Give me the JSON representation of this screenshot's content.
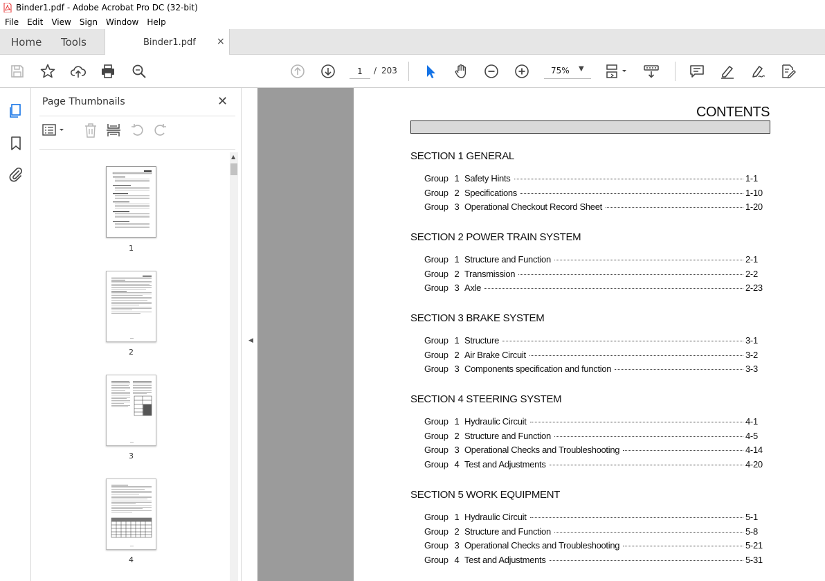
{
  "window": {
    "title": "Binder1.pdf - Adobe Acrobat Pro DC (32-bit)"
  },
  "menu": [
    "File",
    "Edit",
    "View",
    "Sign",
    "Window",
    "Help"
  ],
  "tabs": {
    "home": "Home",
    "tools": "Tools",
    "document": "Binder1.pdf",
    "close_glyph": "×"
  },
  "toolbar": {
    "page_current": "1",
    "page_separator": "/",
    "page_total": "203",
    "zoom": "75%",
    "icons": [
      "save-icon",
      "star-icon",
      "upload-cloud-icon",
      "print-icon",
      "zoom-search-icon",
      "prev-page-icon",
      "next-page-icon",
      "select-cursor-icon",
      "hand-icon",
      "zoom-out-icon",
      "zoom-in-icon",
      "page-display-icon",
      "scroll-mode-icon",
      "comment-icon",
      "highlight-icon",
      "sign-icon",
      "edit-pdf-icon"
    ]
  },
  "sidebar": {
    "panel_title": "Page Thumbnails",
    "close_glyph": "✕",
    "thumbnails": [
      {
        "label": "1"
      },
      {
        "label": "2"
      },
      {
        "label": "3"
      },
      {
        "label": "4"
      }
    ]
  },
  "document": {
    "heading": "CONTENTS",
    "sections": [
      {
        "title": "SECTION 1  GENERAL",
        "groups": [
          {
            "group": "Group",
            "num": "1",
            "title": "Safety Hints",
            "page": "1-1"
          },
          {
            "group": "Group",
            "num": "2",
            "title": "Specifications",
            "page": "1-10"
          },
          {
            "group": "Group",
            "num": "3",
            "title": "Operational Checkout Record Sheet",
            "page": "1-20"
          }
        ]
      },
      {
        "title": "SECTION 2  POWER TRAIN SYSTEM",
        "groups": [
          {
            "group": "Group",
            "num": "1",
            "title": "Structure and Function",
            "page": "2-1"
          },
          {
            "group": "Group",
            "num": "2",
            "title": "Transmission",
            "page": "2-2"
          },
          {
            "group": "Group",
            "num": "3",
            "title": "Axle",
            "page": "2-23"
          }
        ]
      },
      {
        "title": "SECTION 3  BRAKE SYSTEM",
        "groups": [
          {
            "group": "Group",
            "num": "1",
            "title": "Structure",
            "page": "3-1"
          },
          {
            "group": "Group",
            "num": "2",
            "title": "Air Brake Circuit",
            "page": "3-2"
          },
          {
            "group": "Group",
            "num": "3",
            "title": "Components specification and function",
            "page": "3-3"
          }
        ]
      },
      {
        "title": "SECTION 4  STEERING SYSTEM",
        "groups": [
          {
            "group": "Group",
            "num": "1",
            "title": "Hydraulic Circuit",
            "page": "4-1"
          },
          {
            "group": "Group",
            "num": "2",
            "title": "Structure and Function",
            "page": "4-5"
          },
          {
            "group": "Group",
            "num": "3",
            "title": "Operational Checks and Troubleshooting",
            "page": "4-14"
          },
          {
            "group": "Group",
            "num": "4",
            "title": "Test and Adjustments",
            "page": "4-20"
          }
        ]
      },
      {
        "title": "SECTION 5  WORK EQUIPMENT",
        "groups": [
          {
            "group": "Group",
            "num": "1",
            "title": "Hydraulic Circuit",
            "page": "5-1"
          },
          {
            "group": "Group",
            "num": "2",
            "title": "Structure and Function",
            "page": "5-8"
          },
          {
            "group": "Group",
            "num": "3",
            "title": "Operational Checks and Troubleshooting",
            "page": "5-21"
          },
          {
            "group": "Group",
            "num": "4",
            "title": "Test and Adjustments",
            "page": "5-31"
          }
        ]
      }
    ]
  },
  "colors": {
    "accent": "#1473e6",
    "acrobat_red": "#e62e2d",
    "canvas": "#9b9b9b"
  }
}
